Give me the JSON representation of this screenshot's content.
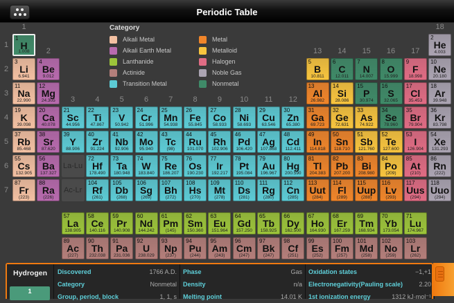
{
  "header": {
    "title": "Periodic Table",
    "menu_icon": "grid-dots-icon"
  },
  "groups": [
    "1",
    "2",
    "3",
    "4",
    "5",
    "6",
    "7",
    "8",
    "9",
    "10",
    "11",
    "12",
    "13",
    "14",
    "15",
    "16",
    "17",
    "18"
  ],
  "periods": [
    "1",
    "2",
    "3",
    "4",
    "5",
    "6",
    "7"
  ],
  "legend": {
    "title": "Category",
    "items": [
      {
        "key": "alkali",
        "label": "Alkali Metal",
        "color": "#f3c0a2"
      },
      {
        "key": "alkaline",
        "label": "Alkali Earth Metal",
        "color": "#b86aae"
      },
      {
        "key": "lanthanide",
        "label": "Lanthanide",
        "color": "#9cc43a"
      },
      {
        "key": "actinide",
        "label": "Actinide",
        "color": "#b47e7a"
      },
      {
        "key": "transition",
        "label": "Transition Metal",
        "color": "#5ccbd5"
      },
      {
        "key": "metal",
        "label": "Metal",
        "color": "#f0852a"
      },
      {
        "key": "metalloid",
        "label": "Metalloid",
        "color": "#f8c43e"
      },
      {
        "key": "halogen",
        "label": "Halogen",
        "color": "#e06c84"
      },
      {
        "key": "noble",
        "label": "Noble Gas",
        "color": "#aba4b2"
      },
      {
        "key": "nonmetal",
        "label": "Nonmetal",
        "color": "#3f8a68"
      }
    ]
  },
  "placeholders": {
    "lanthanides": "La-Lu",
    "actinides": "Ac-Lr"
  },
  "selected": 1,
  "elements": [
    [
      1,
      "H",
      "1.008",
      "nonmetal",
      1,
      1
    ],
    [
      2,
      "He",
      "4.003",
      "noble",
      1,
      18
    ],
    [
      3,
      "Li",
      "6.941",
      "alkali",
      2,
      1
    ],
    [
      4,
      "Be",
      "9.012",
      "alkaline",
      2,
      2
    ],
    [
      5,
      "B",
      "10.811",
      "metalloid",
      2,
      13
    ],
    [
      6,
      "C",
      "12.011",
      "nonmetal",
      2,
      14
    ],
    [
      7,
      "N",
      "14.007",
      "nonmetal",
      2,
      15
    ],
    [
      8,
      "O",
      "15.999",
      "nonmetal",
      2,
      16
    ],
    [
      9,
      "F",
      "18.998",
      "halogen",
      2,
      17
    ],
    [
      10,
      "Ne",
      "20.180",
      "noble",
      2,
      18
    ],
    [
      11,
      "Na",
      "22.990",
      "alkali",
      3,
      1
    ],
    [
      12,
      "Mg",
      "24.305",
      "alkaline",
      3,
      2
    ],
    [
      13,
      "Al",
      "26.982",
      "metal",
      3,
      13
    ],
    [
      14,
      "Si",
      "28.086",
      "metalloid",
      3,
      14
    ],
    [
      15,
      "P",
      "30.974",
      "nonmetal",
      3,
      15
    ],
    [
      16,
      "S",
      "32.065",
      "nonmetal",
      3,
      16
    ],
    [
      17,
      "Cl",
      "35.453",
      "halogen",
      3,
      17
    ],
    [
      18,
      "Ar",
      "39.948",
      "noble",
      3,
      18
    ],
    [
      19,
      "K",
      "39.098",
      "alkali",
      4,
      1
    ],
    [
      20,
      "Ca",
      "40.078",
      "alkaline",
      4,
      2
    ],
    [
      21,
      "Sc",
      "44.956",
      "transition",
      4,
      3
    ],
    [
      22,
      "Ti",
      "47.867",
      "transition",
      4,
      4
    ],
    [
      23,
      "V",
      "50.942",
      "transition",
      4,
      5
    ],
    [
      24,
      "Cr",
      "51.996",
      "transition",
      4,
      6
    ],
    [
      25,
      "Mn",
      "54.938",
      "transition",
      4,
      7
    ],
    [
      26,
      "Fe",
      "55.845",
      "transition",
      4,
      8
    ],
    [
      27,
      "Co",
      "58.933",
      "transition",
      4,
      9
    ],
    [
      28,
      "Ni",
      "58.693",
      "transition",
      4,
      10
    ],
    [
      29,
      "Cu",
      "63.546",
      "transition",
      4,
      11
    ],
    [
      30,
      "Zn",
      "65.380",
      "transition",
      4,
      12
    ],
    [
      31,
      "Ga",
      "69.723",
      "metal",
      4,
      13
    ],
    [
      32,
      "Ge",
      "72.631",
      "metalloid",
      4,
      14
    ],
    [
      33,
      "As",
      "74.922",
      "metalloid",
      4,
      15
    ],
    [
      34,
      "Se",
      "78.960",
      "nonmetal",
      4,
      16
    ],
    [
      35,
      "Br",
      "79.904",
      "halogen",
      4,
      17
    ],
    [
      36,
      "Kr",
      "83.798",
      "noble",
      4,
      18
    ],
    [
      37,
      "Rb",
      "85.468",
      "alkali",
      5,
      1
    ],
    [
      38,
      "Sr",
      "87.620",
      "alkaline",
      5,
      2
    ],
    [
      39,
      "Y",
      "88.906",
      "transition",
      5,
      3
    ],
    [
      40,
      "Zr",
      "91.224",
      "transition",
      5,
      4
    ],
    [
      41,
      "Nb",
      "92.906",
      "transition",
      5,
      5
    ],
    [
      42,
      "Mo",
      "95.940",
      "transition",
      5,
      6
    ],
    [
      43,
      "Tc",
      "(98)",
      "transition",
      5,
      7
    ],
    [
      44,
      "Ru",
      "101.070",
      "transition",
      5,
      8
    ],
    [
      45,
      "Rh",
      "102.906",
      "transition",
      5,
      9
    ],
    [
      46,
      "Pd",
      "106.420",
      "transition",
      5,
      10
    ],
    [
      47,
      "Ag",
      "107.868",
      "transition",
      5,
      11
    ],
    [
      48,
      "Cd",
      "112.411",
      "transition",
      5,
      12
    ],
    [
      49,
      "In",
      "114.818",
      "metal",
      5,
      13
    ],
    [
      50,
      "Sn",
      "118.710",
      "metal",
      5,
      14
    ],
    [
      51,
      "Sb",
      "121.760",
      "metalloid",
      5,
      15
    ],
    [
      52,
      "Te",
      "127.600",
      "metalloid",
      5,
      16
    ],
    [
      53,
      "I",
      "126.904",
      "halogen",
      5,
      17
    ],
    [
      54,
      "Xe",
      "131.293",
      "noble",
      5,
      18
    ],
    [
      55,
      "Cs",
      "132.905",
      "alkali",
      6,
      1
    ],
    [
      56,
      "Ba",
      "137.327",
      "alkaline",
      6,
      2
    ],
    [
      72,
      "Hf",
      "178.490",
      "transition",
      6,
      4
    ],
    [
      73,
      "Ta",
      "180.948",
      "transition",
      6,
      5
    ],
    [
      74,
      "W",
      "183.840",
      "transition",
      6,
      6
    ],
    [
      75,
      "Re",
      "186.207",
      "transition",
      6,
      7
    ],
    [
      76,
      "Os",
      "190.230",
      "transition",
      6,
      8
    ],
    [
      77,
      "Ir",
      "192.217",
      "transition",
      6,
      9
    ],
    [
      78,
      "Pt",
      "195.084",
      "transition",
      6,
      10
    ],
    [
      79,
      "Au",
      "196.967",
      "transition",
      6,
      11
    ],
    [
      80,
      "Hg",
      "200.590",
      "transition",
      6,
      12
    ],
    [
      81,
      "Tl",
      "204.383",
      "metal",
      6,
      13
    ],
    [
      82,
      "Pb",
      "207.200",
      "metal",
      6,
      14
    ],
    [
      83,
      "Bi",
      "208.980",
      "metal",
      6,
      15
    ],
    [
      84,
      "Po",
      "(209)",
      "metalloid",
      6,
      16
    ],
    [
      85,
      "At",
      "(210)",
      "halogen",
      6,
      17
    ],
    [
      86,
      "Rn",
      "(222)",
      "noble",
      6,
      18
    ],
    [
      87,
      "Fr",
      "(223)",
      "alkali",
      7,
      1
    ],
    [
      88,
      "Ra",
      "(226)",
      "alkaline",
      7,
      2
    ],
    [
      104,
      "Rf",
      "(261)",
      "transition",
      7,
      4
    ],
    [
      105,
      "Db",
      "(268)",
      "transition",
      7,
      5
    ],
    [
      106,
      "Sg",
      "(269)",
      "transition",
      7,
      6
    ],
    [
      107,
      "Bh",
      "(272)",
      "transition",
      7,
      7
    ],
    [
      108,
      "Hs",
      "(270)",
      "transition",
      7,
      8
    ],
    [
      109,
      "Mt",
      "(278)",
      "transition",
      7,
      9
    ],
    [
      110,
      "Ds",
      "(281)",
      "transition",
      7,
      10
    ],
    [
      111,
      "Rg",
      "(280)",
      "transition",
      7,
      11
    ],
    [
      112,
      "Cn",
      "(285)",
      "transition",
      7,
      12
    ],
    [
      113,
      "Uut",
      "(284)",
      "metal",
      7,
      13
    ],
    [
      114,
      "Fl",
      "(289)",
      "metal",
      7,
      14
    ],
    [
      115,
      "Uup",
      "(288)",
      "metal",
      7,
      15
    ],
    [
      116,
      "Lv",
      "(293)",
      "metal",
      7,
      16
    ],
    [
      117,
      "Uus",
      "(294)",
      "halogen",
      7,
      17
    ],
    [
      118,
      "Uuo",
      "(294)",
      "noble",
      7,
      18
    ]
  ],
  "lanthanides": [
    [
      57,
      "La",
      "138.905"
    ],
    [
      58,
      "Ce",
      "140.116"
    ],
    [
      59,
      "Pr",
      "140.908"
    ],
    [
      60,
      "Nd",
      "144.242"
    ],
    [
      61,
      "Pm",
      "(145)"
    ],
    [
      62,
      "Sm",
      "150.360"
    ],
    [
      63,
      "Eu",
      "151.964"
    ],
    [
      64,
      "Gd",
      "157.250"
    ],
    [
      65,
      "Tb",
      "158.925"
    ],
    [
      66,
      "Dy",
      "162.500"
    ],
    [
      67,
      "Ho",
      "164.930"
    ],
    [
      68,
      "Er",
      "167.259"
    ],
    [
      69,
      "Tm",
      "168.934"
    ],
    [
      70,
      "Yb",
      "173.054"
    ],
    [
      71,
      "Lu",
      "174.967"
    ]
  ],
  "actinides": [
    [
      89,
      "Ac",
      "(227)"
    ],
    [
      90,
      "Th",
      "232.038"
    ],
    [
      91,
      "Pa",
      "231.036"
    ],
    [
      92,
      "U",
      "238.029"
    ],
    [
      93,
      "Np",
      "(237)"
    ],
    [
      94,
      "Pu",
      "(244)"
    ],
    [
      95,
      "Am",
      "(243)"
    ],
    [
      96,
      "Cm",
      "(247)"
    ],
    [
      97,
      "Bk",
      "(247)"
    ],
    [
      98,
      "Cf",
      "(251)"
    ],
    [
      99,
      "Es",
      "(252)"
    ],
    [
      100,
      "Fm",
      "(257)"
    ],
    [
      101,
      "Md",
      "(258)"
    ],
    [
      102,
      "No",
      "(259)"
    ],
    [
      103,
      "Lr",
      "(262)"
    ]
  ],
  "details": {
    "name": "Hydrogen",
    "number": "1",
    "columns": [
      [
        {
          "k": "Discovered",
          "v": "1766 A.D."
        },
        {
          "k": "Category",
          "v": "Nonmetal"
        },
        {
          "k": "Group, period, block",
          "v": "1, 1, s"
        }
      ],
      [
        {
          "k": "Phase",
          "v": "Gas"
        },
        {
          "k": "Density",
          "v": "n/a"
        },
        {
          "k": "Melting point",
          "v": "14.01 K"
        }
      ],
      [
        {
          "k": "Oxidation states",
          "v": "−1,+1"
        },
        {
          "k": "Electronegativity(Pauling scale)",
          "v": "2.20"
        },
        {
          "k": "1st ionization energy",
          "v": "1312 kJ·mol⁻¹"
        }
      ]
    ]
  }
}
